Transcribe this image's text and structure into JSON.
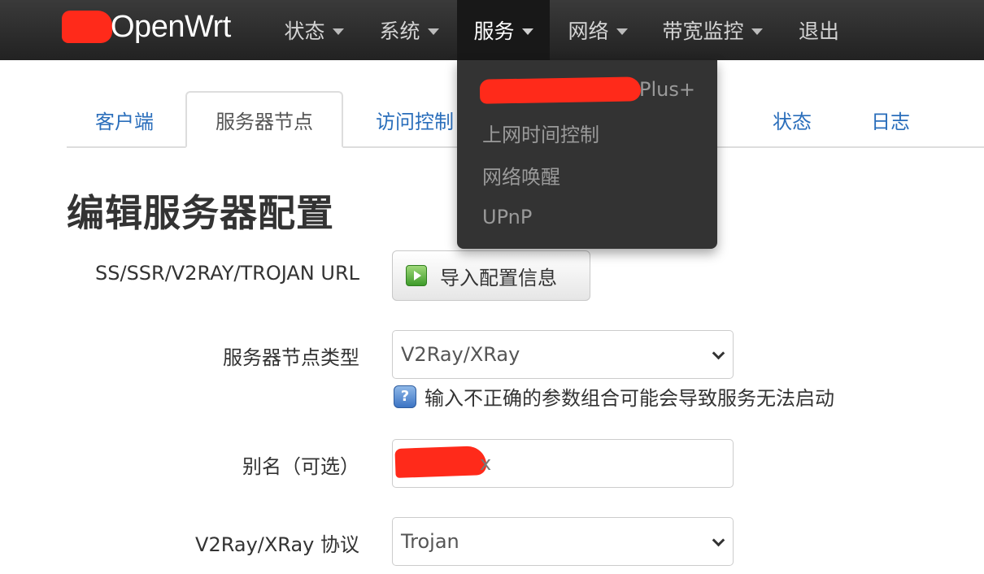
{
  "brand": {
    "name": "OpenWrt",
    "redaction_color": "#ff2a1a"
  },
  "nav": {
    "items": [
      {
        "label": "状态",
        "has_caret": true
      },
      {
        "label": "系统",
        "has_caret": true
      },
      {
        "label": "服务",
        "has_caret": true,
        "active": true
      },
      {
        "label": "网络",
        "has_caret": true
      },
      {
        "label": "带宽监控",
        "has_caret": true
      },
      {
        "label": "退出",
        "has_caret": false
      }
    ]
  },
  "dropdown": {
    "items": [
      {
        "label": "Plus+",
        "redacted_prefix": true
      },
      {
        "label": "上网时间控制"
      },
      {
        "label": "网络唤醒"
      },
      {
        "label": "UPnP"
      }
    ]
  },
  "tabs": [
    {
      "label": "客户端"
    },
    {
      "label": "服务器节点",
      "active": true
    },
    {
      "label": "访问控制"
    },
    {
      "label": "状态"
    },
    {
      "label": "日志"
    }
  ],
  "page": {
    "title": "编辑服务器配置",
    "fields": {
      "import": {
        "label": "SS/SSR/V2RAY/TROJAN URL",
        "button": "导入配置信息",
        "icon": "play-icon"
      },
      "node_type": {
        "label": "服务器节点类型",
        "value": "V2Ray/XRay",
        "hint": "输入不正确的参数组合可能会导致服务无法启动",
        "hint_icon": "help-icon"
      },
      "alias": {
        "label": "别名（可选）",
        "value_tail": "x"
      },
      "protocol": {
        "label": "V2Ray/XRay 协议",
        "value": "Trojan"
      }
    }
  },
  "colors": {
    "navbar": "#222222",
    "link": "#2a6ebb",
    "dropdown_bg": "#333333"
  }
}
